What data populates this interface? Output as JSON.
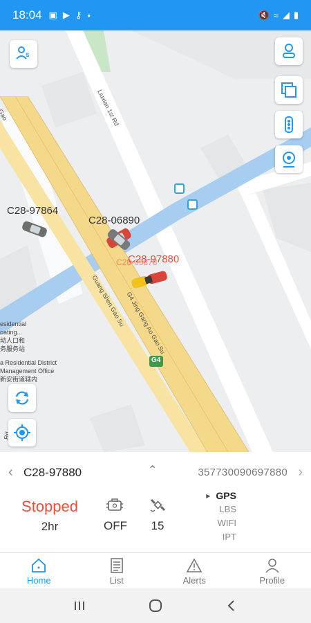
{
  "status_bar": {
    "time": "18:04"
  },
  "map": {
    "cars": [
      {
        "label": "C28-97864",
        "style": "normal"
      },
      {
        "label": "C28-06890",
        "style": "normal"
      },
      {
        "label": "C28-97880",
        "style": "red"
      },
      {
        "label": "C28-05878",
        "style": "red"
      }
    ],
    "roads": [
      {
        "name": "Liuxian 1st Rd"
      },
      {
        "name": "Guang Shen Gao Su"
      },
      {
        "name": "G4 Jing Gang Ao Gao Su"
      },
      {
        "name": "Gao"
      },
      {
        "name": "Rd"
      }
    ],
    "shield": "G4",
    "pois": [
      {
        "name": "esidential\noating...\n动人口和\n务服务站"
      },
      {
        "name": "a Residential District\nManagement Office\n新安街道辖内"
      }
    ]
  },
  "panel": {
    "plate": "C28-97880",
    "imei": "357730090697880",
    "status": "Stopped",
    "duration": "2hr",
    "acc": "OFF",
    "satellites": "15",
    "location_modes": [
      "GPS",
      "LBS",
      "WIFI",
      "IPT"
    ],
    "active_mode": "GPS"
  },
  "tabs": [
    {
      "label": "Home",
      "icon": "home-icon",
      "active": true
    },
    {
      "label": "List",
      "icon": "list-icon",
      "active": false
    },
    {
      "label": "Alerts",
      "icon": "alert-icon",
      "active": false
    },
    {
      "label": "Profile",
      "icon": "profile-icon",
      "active": false
    }
  ],
  "colors": {
    "accent": "#2196f3",
    "status_stopped": "#e8503a",
    "highway": "#f5d98a",
    "water": "#a7cdf0"
  }
}
